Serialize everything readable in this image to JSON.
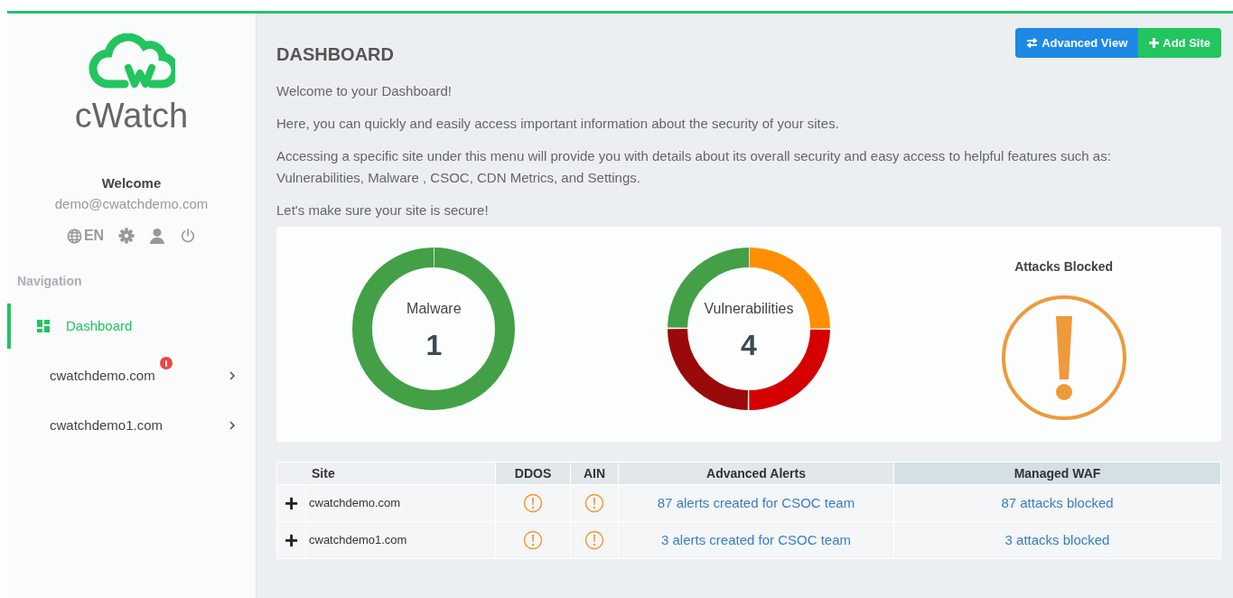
{
  "sidebar": {
    "logo_text": "cWatch",
    "welcome": "Welcome",
    "email": "demo@cwatchdemo.com",
    "language": "EN",
    "section_label": "Navigation",
    "items": [
      {
        "label": "Dashboard",
        "selected": true,
        "alert": false,
        "chevron": false
      },
      {
        "label": "cwatchdemo.com",
        "selected": false,
        "alert": true,
        "chevron": true
      },
      {
        "label": "cwatchdemo1.com",
        "selected": false,
        "alert": false,
        "chevron": true
      }
    ]
  },
  "header": {
    "title": "DASHBOARD",
    "buttons": [
      {
        "label": "Advanced View",
        "kind": "swap"
      },
      {
        "label": "Add Site",
        "kind": "add"
      }
    ]
  },
  "intro": [
    "Welcome to your Dashboard!",
    "Here, you can quickly and easily access important information about the security of your sites.",
    "Accessing a specific site under this menu will provide you with details about its overall security and easy access to helpful features such as: Vulnerabilities, Malware , CSOC, CDN Metrics, and Settings.",
    "Let's make sure your site is secure!"
  ],
  "widgets": [
    {
      "kind": "donut",
      "label": "Malware",
      "count": "1",
      "segments": [
        {
          "color": "#43a047"
        }
      ]
    },
    {
      "kind": "donut",
      "label": "Vulnerabilities",
      "count": "4",
      "segments": [
        {
          "color": "#ff8f00"
        },
        {
          "color": "#d50000"
        },
        {
          "color": "#9b0a0a"
        },
        {
          "color": "#43a047"
        }
      ]
    },
    {
      "kind": "alert",
      "label": "Attacks Blocked"
    }
  ],
  "table": {
    "columns": [
      "Site",
      "DDOS",
      "AIN",
      "Advanced Alerts",
      "Managed WAF"
    ],
    "rows": [
      {
        "expand": "+",
        "site": "cwatchdemo.com",
        "alerts": "87 alerts created for CSOC team",
        "waf": "87 attacks blocked"
      },
      {
        "expand": "+",
        "site": "cwatchdemo1.com",
        "alerts": "3 alerts created for CSOC team",
        "waf": "3 attacks blocked"
      }
    ]
  }
}
